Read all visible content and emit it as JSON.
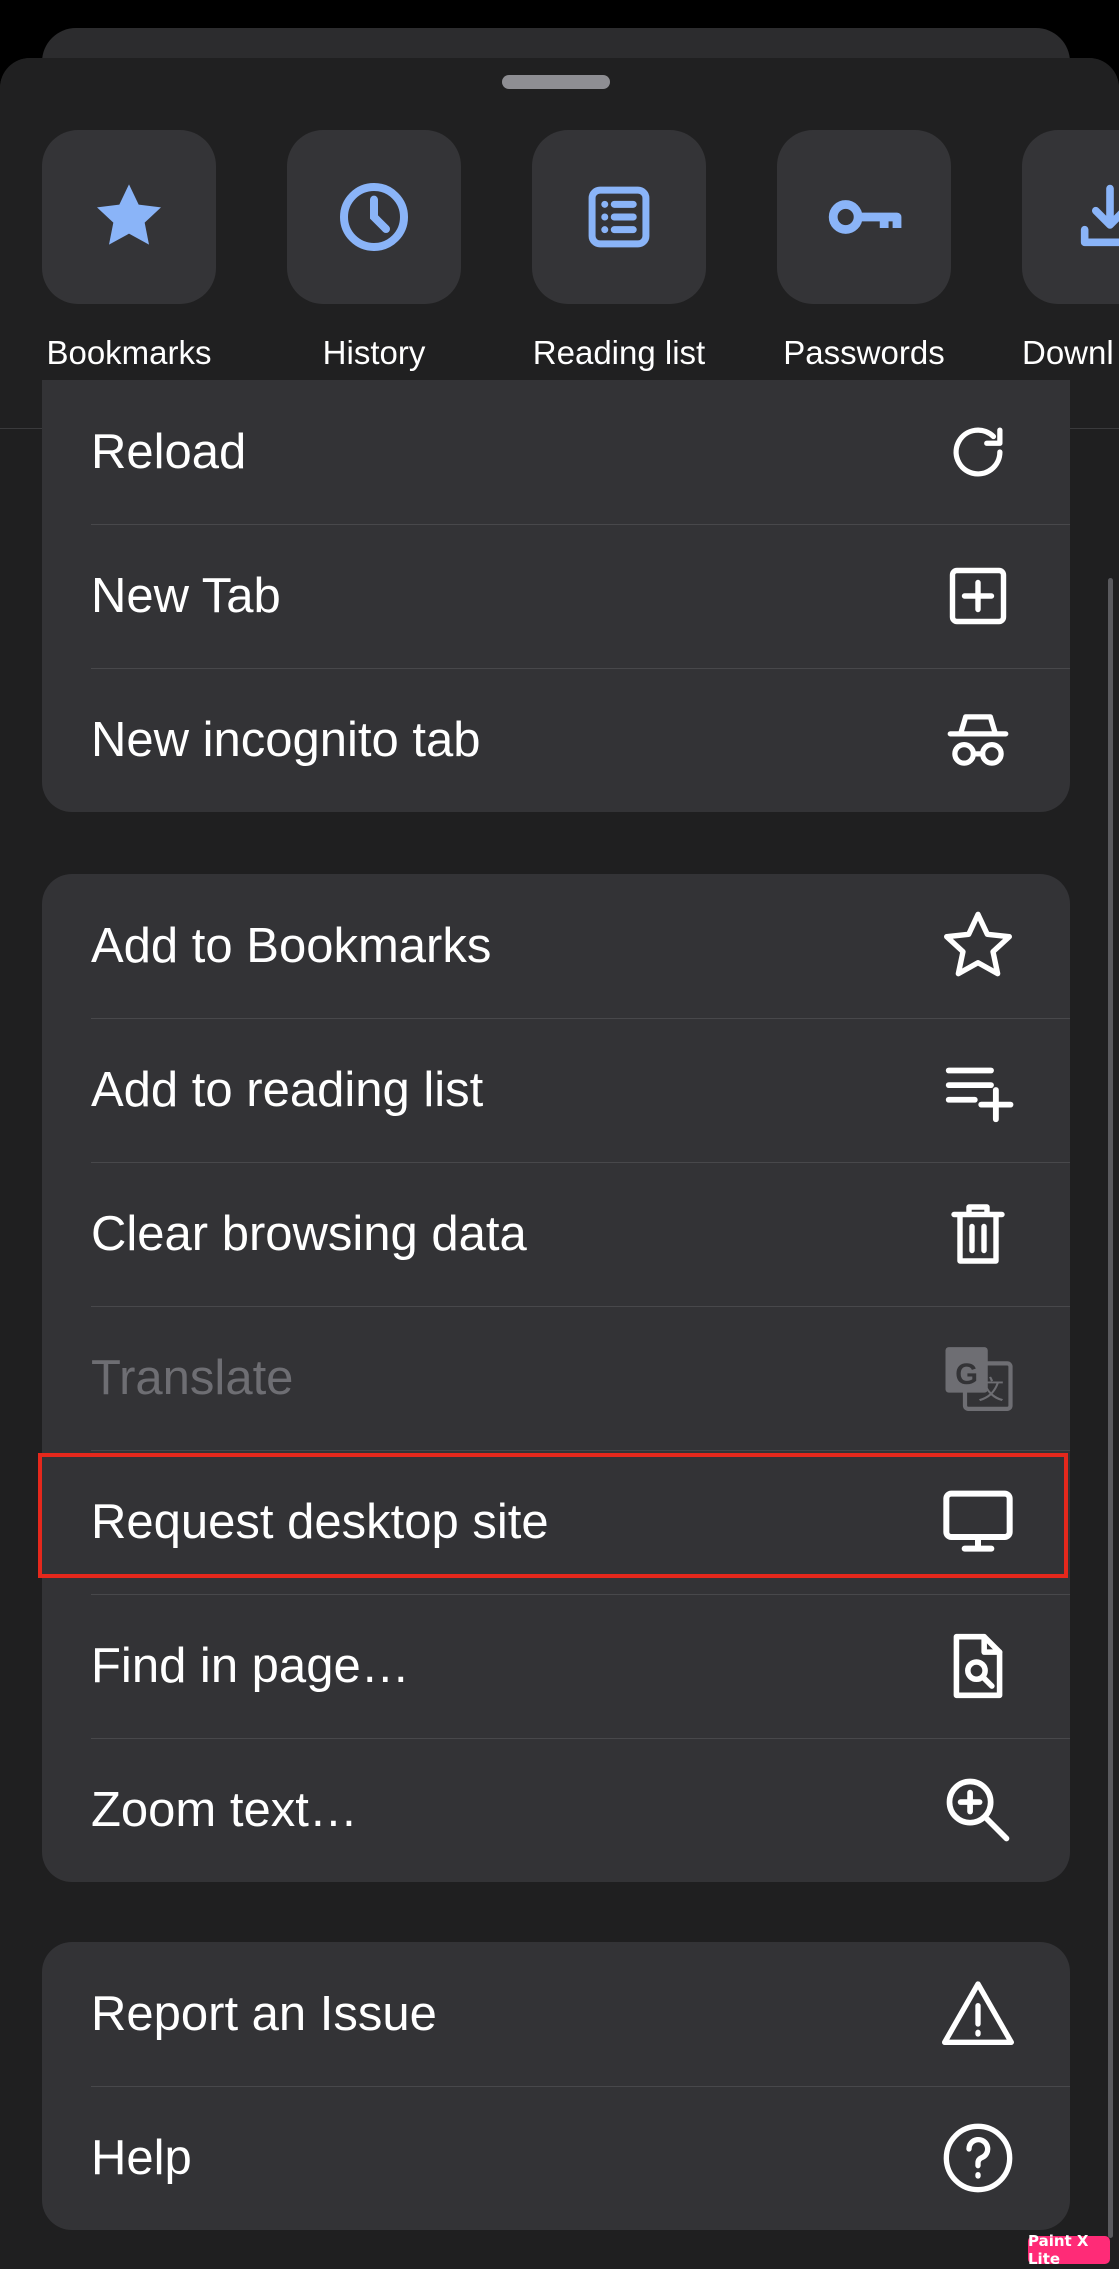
{
  "quick_actions": [
    {
      "label": "Bookmarks",
      "icon": "star-icon"
    },
    {
      "label": "History",
      "icon": "clock-icon"
    },
    {
      "label": "Reading list",
      "icon": "reading-list-icon"
    },
    {
      "label": "Passwords",
      "icon": "key-icon"
    },
    {
      "label": "Downl",
      "icon": "download-icon"
    }
  ],
  "menu_groups": [
    [
      {
        "label": "Reload",
        "icon": "reload-icon"
      },
      {
        "label": "New Tab",
        "icon": "new-tab-icon"
      },
      {
        "label": "New incognito tab",
        "icon": "incognito-icon"
      }
    ],
    [
      {
        "label": "Add to Bookmarks",
        "icon": "star-outline-icon"
      },
      {
        "label": "Add to reading list",
        "icon": "add-to-list-icon"
      },
      {
        "label": "Clear browsing data",
        "icon": "trash-icon"
      },
      {
        "label": "Translate",
        "icon": "translate-icon",
        "disabled": true
      },
      {
        "label": "Request desktop site",
        "icon": "desktop-icon"
      },
      {
        "label": "Find in page…",
        "icon": "find-in-page-icon"
      },
      {
        "label": "Zoom text…",
        "icon": "zoom-in-icon"
      }
    ],
    [
      {
        "label": "Report an Issue",
        "icon": "warning-icon"
      },
      {
        "label": "Help",
        "icon": "help-icon"
      }
    ]
  ],
  "watermark": "Paint X Lite",
  "colors": {
    "accent": "#8ab4f8",
    "highlight": "#e5281c",
    "card": "#333336",
    "disabled_text": "#6e6e73"
  }
}
